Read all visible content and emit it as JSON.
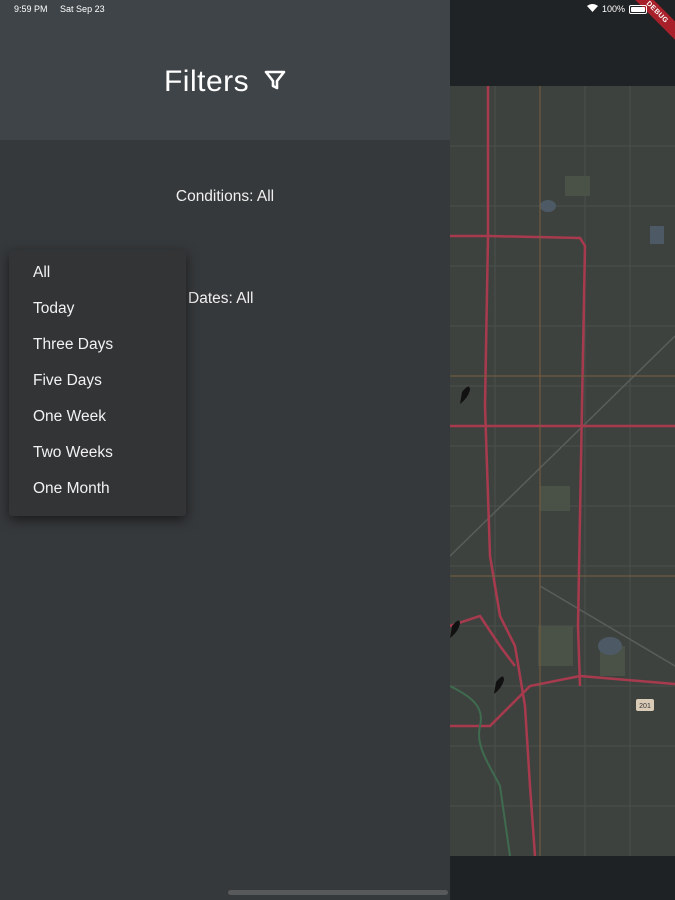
{
  "status_bar": {
    "time": "9:59 PM",
    "date": "Sat Sep 23",
    "battery": "100%",
    "debug": "DEBUG"
  },
  "drawer": {
    "title": "Filters",
    "conditions_label": "Conditions: All",
    "dates_label": "Dates: All"
  },
  "dates_dropdown": {
    "options": [
      "All",
      "Today",
      "Three Days",
      "Five Days",
      "One Week",
      "Two Weeks",
      "One Month"
    ]
  },
  "map": {
    "road_label": "201"
  },
  "colors": {
    "drawer_bg": "#36393b",
    "drawer_header_bg": "#3f4448",
    "dropdown_bg": "#323436",
    "road_red": "#a83a4e"
  }
}
